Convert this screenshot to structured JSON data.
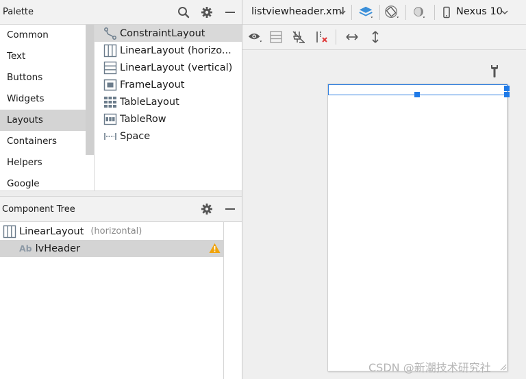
{
  "palette": {
    "title": "Palette",
    "categories": [
      "Common",
      "Text",
      "Buttons",
      "Widgets",
      "Layouts",
      "Containers",
      "Helpers",
      "Google"
    ],
    "selected_category": "Layouts",
    "widgets": [
      {
        "label": "ConstraintLayout",
        "icon": "constraint-layout-icon"
      },
      {
        "label": "LinearLayout (horizo...",
        "icon": "linear-layout-horizontal-icon"
      },
      {
        "label": "LinearLayout (vertical)",
        "icon": "linear-layout-vertical-icon"
      },
      {
        "label": "FrameLayout",
        "icon": "frame-layout-icon"
      },
      {
        "label": "TableLayout",
        "icon": "table-layout-icon"
      },
      {
        "label": "TableRow",
        "icon": "table-row-icon"
      },
      {
        "label": "Space",
        "icon": "space-icon"
      }
    ],
    "selected_widget": "ConstraintLayout"
  },
  "component_tree": {
    "title": "Component Tree",
    "nodes": [
      {
        "label": "LinearLayout",
        "detail": "(horizontal)",
        "icon": "linear-layout-horizontal-icon"
      },
      {
        "label": "lvHeader",
        "badge": "Ab",
        "icon": "textview-icon",
        "warning": true
      }
    ]
  },
  "editor": {
    "file_tab": "listviewheader.xml",
    "device": "Nexus 10"
  },
  "watermark": "CSDN @新潮技术研究社",
  "colors": {
    "accent": "#1f7ae8",
    "selection": "#d4d4d4",
    "warning": "#f0a30a",
    "layer_icon": "#3a8fd9"
  }
}
